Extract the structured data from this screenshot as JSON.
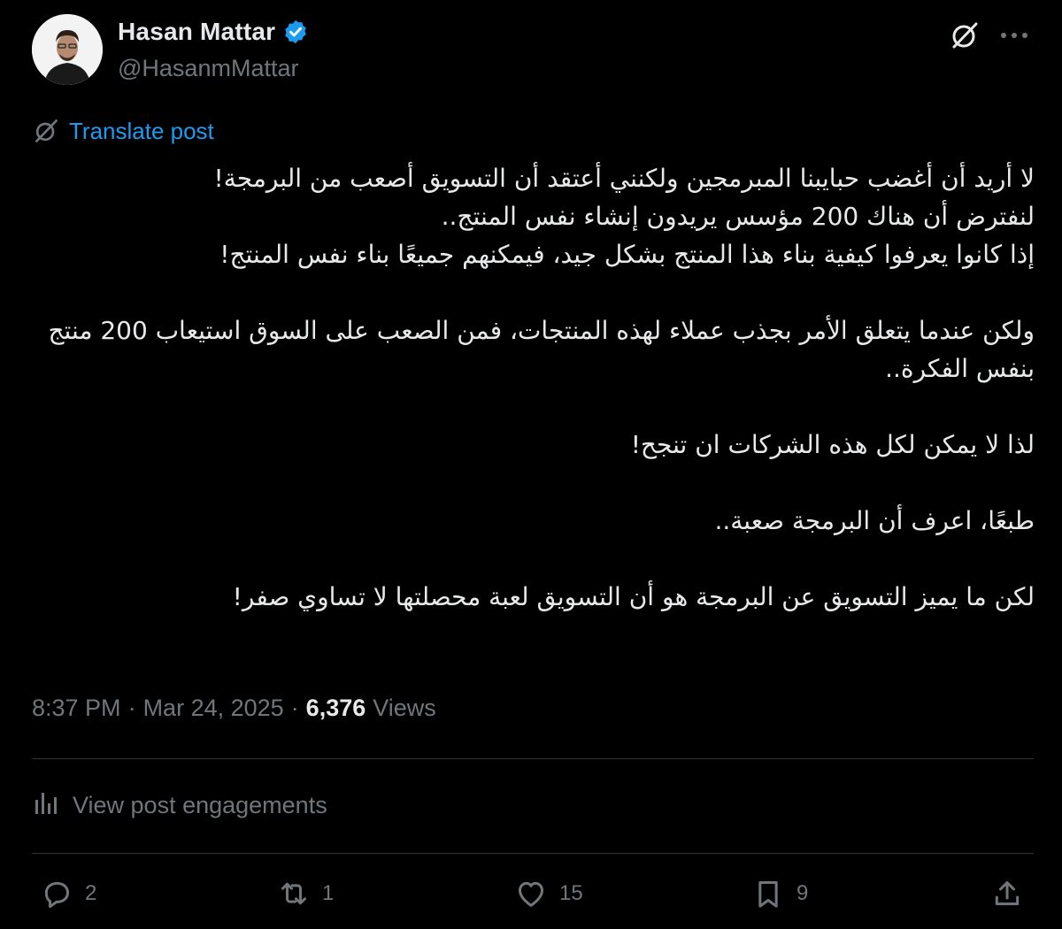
{
  "author": {
    "display_name": "Hasan Mattar",
    "handle": "@HasanmMattar",
    "verified_icon": "verified-badge-icon"
  },
  "colors": {
    "background": "#000000",
    "text": "#e7e9ea",
    "muted": "#71767b",
    "accent": "#1d9bf0",
    "divider": "#2f3336"
  },
  "translate": {
    "label": "Translate post"
  },
  "post": {
    "lines": [
      "لا أريد أن أغضب حبايبنا المبرمجين ولكنني أعتقد أن التسويق أصعب من البرمجة!",
      "لنفترض أن هناك 200 مؤسس يريدون إنشاء نفس المنتج..",
      "إذا كانوا يعرفوا كيفية بناء هذا المنتج بشكل جيد، فيمكنهم جميعًا بناء نفس المنتج!",
      "ولكن عندما يتعلق الأمر بجذب عملاء لهذه المنتجات، فمن الصعب على السوق استيعاب 200 منتج بنفس الفكرة..",
      "لذا لا يمكن لكل هذه الشركات ان تنجح!",
      "طبعًا، اعرف أن البرمجة صعبة..",
      "لكن ما يميز التسويق عن البرمجة هو أن التسويق لعبة محصلتها لا تساوي صفر!"
    ]
  },
  "meta": {
    "time": "8:37 PM",
    "date": "Mar 24, 2025",
    "separator": "·",
    "views_count": "6,376",
    "views_label": "Views"
  },
  "engagements": {
    "label": "View post engagements"
  },
  "actions": {
    "replies": "2",
    "reposts": "1",
    "likes": "15",
    "bookmarks": "9"
  }
}
